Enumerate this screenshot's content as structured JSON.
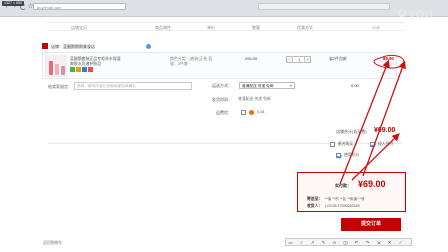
{
  "browser": {
    "dim_badge": "1327 × 650",
    "url": "buy.tmall.com",
    "nav": {
      "back": "‹",
      "forward": "›",
      "star": "☆"
    }
  },
  "watermark": {
    "text": "YOU"
  },
  "table": {
    "columns": [
      "店铺宝贝",
      "商品属性",
      "单价",
      "数量",
      "优惠方式",
      "小计"
    ]
  },
  "shop": {
    "label": "店铺：蓝腿鹅鹅鹅美妆店"
  },
  "item": {
    "title": "蓝腿鹅套装正品专柜补水保湿爽肤水乳液护肤品",
    "sku": "颜色分类：[套装]正装 容量：3件套",
    "price": "294.00",
    "qty": "1",
    "qty_minus": "−",
    "qty_plus": "+",
    "shipping": "省2件包邮",
    "subtotal": "69.00"
  },
  "options": {
    "message_label": "给卖家留言：",
    "message_placeholder": "选填：填写内容已经和卖家协商确认",
    "shipping_label": "运送方式：",
    "shipping_value": "普通配送 快递 免邮",
    "shipping_chevron": "▾",
    "shipping_fee": "0.00",
    "shipping_desc_label": "发货时间：",
    "shipping_desc": "普通配送·快递 免邮",
    "insurance_label": "运费险：",
    "insurance_price": "0.28",
    "shop_total_label": "店铺合计(含运费)",
    "shop_total": "¥69.00",
    "anonymous_label": "匿名购买",
    "pay_label": "找人代付",
    "points_label": "使用积分",
    "back_link": "返回购物车"
  },
  "summary": {
    "pay_label": "实付款：",
    "pay_total": "¥69.00",
    "addr_label": "寄送至：",
    "addr": "**省 **市 **区 **街道 **号",
    "recv_label": "收货人：",
    "recv": "LOO35 17090263349",
    "submit": "提交订单"
  },
  "anno_toolbar": {
    "tools": [
      "▭",
      "○",
      "↗",
      "✎",
      "A",
      "◫",
      "↶",
      "↷",
      "⇲",
      "✕",
      "✓"
    ]
  },
  "colors": {
    "accent": "#c40000",
    "annotation_red": "#d01010"
  }
}
